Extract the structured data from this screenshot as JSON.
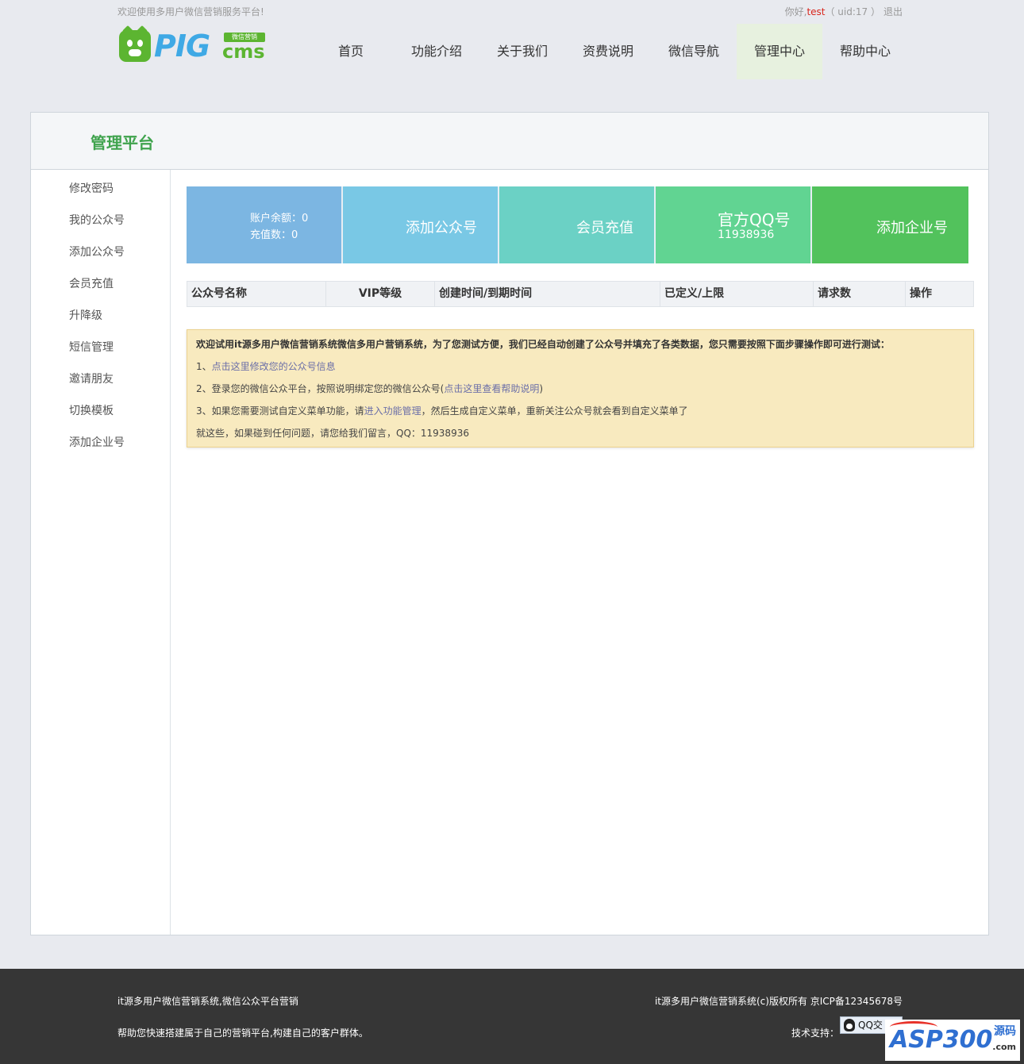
{
  "topbar": {
    "welcome": "欢迎使用多用户微信营销服务平台!",
    "hello": "你好,",
    "username": "test",
    "uid": "（ uid:17 ）",
    "logout": "退出"
  },
  "logo": {
    "brand": "PIG",
    "cms": "cms",
    "tag": "微信营销"
  },
  "nav": [
    "首页",
    "功能介绍",
    "关于我们",
    "资费说明",
    "微信导航",
    "管理中心",
    "帮助中心"
  ],
  "nav_active": "管理中心",
  "panel": {
    "title": "管理平台"
  },
  "sidebar": [
    "修改密码",
    "我的公众号",
    "添加公众号",
    "会员充值",
    "升降级",
    "短信管理",
    "邀请朋友",
    "切换模板",
    "添加企业号"
  ],
  "tiles": {
    "balance_label": "账户余额：0",
    "recharge_label": "充值数：0",
    "add_account": "添加公众号",
    "member_recharge": "会员充值",
    "qq_title": "官方QQ号",
    "qq_number": "11938936",
    "add_enterprise": "添加企业号"
  },
  "table": {
    "columns": [
      "公众号名称",
      "VIP等级",
      "创建时间/到期时间",
      "已定义/上限",
      "请求数",
      "操作"
    ]
  },
  "notice": {
    "intro": "欢迎试用it源多用户微信营销系统微信多用户营销系统，为了您测试方便，我们已经自动创建了公众号并填充了各类数据，您只需要按照下面步骤操作即可进行测试：",
    "step1_prefix": "1、",
    "step1_link": "点击这里修改您的公众号信息",
    "step2_prefix": "2、登录您的微信公众平台，按照说明绑定您的微信公众号(",
    "step2_link": "点击这里查看帮助说明",
    "step2_suffix": ")",
    "step3_prefix": "3、如果您需要测试自定义菜单功能，请",
    "step3_link": "进入功能管理",
    "step3_suffix": "，然后生成自定义菜单，重新关注公众号就会看到自定义菜单了",
    "closing": "就这些，如果碰到任何问题，请您给我们留言，QQ：11938936"
  },
  "footer": {
    "left1": "it源多用户微信营销系统,微信公众平台营销",
    "left2": "帮助您快速搭建属于自己的营销平台,构建自己的客户群体。",
    "right1": "it源多用户微信营销系统(c)版权所有 京ICP备12345678号",
    "support_label": "技术支持：",
    "qq_button": "QQ交"
  },
  "watermark": {
    "text": "ASP300",
    "cn": "源码",
    "com": ".com"
  },
  "colors": {
    "accent_green": "#3fa34d",
    "tile_balance": "#7cb6e2",
    "tile_add": "#79c8e5",
    "tile_member": "#6bd1c5",
    "tile_qq": "#61d492",
    "tile_enterprise": "#52c25c",
    "notice_bg": "#f8eabf",
    "footer_bg": "#363636"
  }
}
